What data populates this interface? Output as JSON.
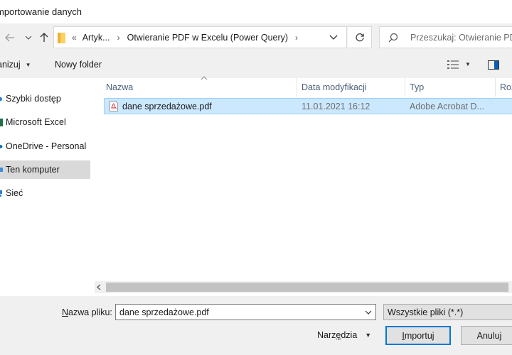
{
  "window": {
    "title": "mportowanie danych"
  },
  "navigation": {
    "breadcrumb_lead": "«",
    "breadcrumbs": [
      "Artyk...",
      "Otwieranie PDF w Excelu (Power Query)"
    ],
    "search_placeholder": "Przeszukaj: Otwieranie PDF"
  },
  "toolbar": {
    "organize_label": "anizuj",
    "new_folder_label": "Nowy folder"
  },
  "sidebar": {
    "items": [
      {
        "label": "Szybki dostęp",
        "icon": "star-icon"
      },
      {
        "label": "Microsoft Excel",
        "icon": "excel-icon"
      },
      {
        "label": "OneDrive - Personal",
        "icon": "cloud-icon"
      },
      {
        "label": "Ten komputer",
        "icon": "computer-icon",
        "selected": true
      },
      {
        "label": "Sieć",
        "icon": "network-icon"
      }
    ]
  },
  "file_list": {
    "columns": [
      "Nazwa",
      "Data modyfikacji",
      "Typ",
      "Roz"
    ],
    "rows": [
      {
        "name": "dane sprzedażowe.pdf",
        "modified": "11.01.2021 16:12",
        "type": "Adobe Acrobat D..."
      }
    ]
  },
  "footer": {
    "filename_label_accel": "N",
    "filename_label_rest": "azwa pliku:",
    "filename_value": "dane sprzedażowe.pdf",
    "filter_value": "Wszystkie pliki (*.*)",
    "tools_pre": "Narz",
    "tools_accel": "ę",
    "tools_post": "dzia",
    "import_accel": "I",
    "import_rest": "mportuj",
    "cancel_label": "Anuluj"
  },
  "colors": {
    "selection_fill": "#cce8ff",
    "selection_border": "#99d1ff",
    "accent": "#0078d7",
    "header_text": "#4c607a"
  }
}
